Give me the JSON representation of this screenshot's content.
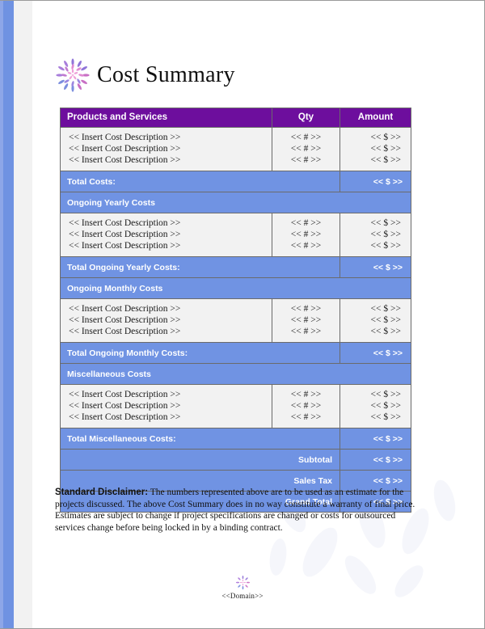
{
  "document": {
    "title": "Cost Summary",
    "logo_icon": "flower-burst-icon",
    "accent_purple": "#6D0E9D",
    "accent_blue": "#7093E3",
    "row_gray": "#F2F2F2"
  },
  "table": {
    "columns": [
      "Products and Services",
      "Qty",
      "Amount"
    ],
    "placeholders": {
      "description": "<< Insert Cost Description >>",
      "qty": "<< # >>",
      "amount": "<< $ >>"
    },
    "rows": [
      {
        "kind": "items",
        "lines": [
          {
            "description": "<< Insert Cost Description >>",
            "qty": "<< # >>",
            "amount": "<< $ >>"
          },
          {
            "description": "<< Insert Cost Description >>",
            "qty": "<< # >>",
            "amount": "<< $ >>"
          },
          {
            "description": "<< Insert Cost Description >>",
            "qty": "<< # >>",
            "amount": "<< $ >>"
          }
        ]
      },
      {
        "kind": "total",
        "label": "Total Costs:",
        "amount": "<< $ >>"
      },
      {
        "kind": "section",
        "label": "Ongoing Yearly Costs"
      },
      {
        "kind": "items",
        "lines": [
          {
            "description": "<< Insert Cost Description >>",
            "qty": "<< # >>",
            "amount": "<< $ >>"
          },
          {
            "description": "<< Insert Cost Description >>",
            "qty": "<< # >>",
            "amount": "<< $ >>"
          },
          {
            "description": "<< Insert Cost Description >>",
            "qty": "<< # >>",
            "amount": "<< $ >>"
          }
        ]
      },
      {
        "kind": "total",
        "label": "Total Ongoing Yearly Costs:",
        "amount": "<< $ >>"
      },
      {
        "kind": "section",
        "label": "Ongoing Monthly Costs"
      },
      {
        "kind": "items",
        "lines": [
          {
            "description": "<< Insert Cost Description >>",
            "qty": "<< # >>",
            "amount": "<< $ >>"
          },
          {
            "description": "<< Insert Cost Description >>",
            "qty": "<< # >>",
            "amount": "<< $ >>"
          },
          {
            "description": "<< Insert Cost Description >>",
            "qty": "<< # >>",
            "amount": "<< $ >>"
          }
        ]
      },
      {
        "kind": "total",
        "label": "Total Ongoing Monthly Costs:",
        "amount": "<< $ >>"
      },
      {
        "kind": "section",
        "label": "Miscellaneous Costs"
      },
      {
        "kind": "items",
        "lines": [
          {
            "description": "<< Insert Cost Description >>",
            "qty": "<< # >>",
            "amount": "<< $ >>"
          },
          {
            "description": "<< Insert Cost Description >>",
            "qty": "<< # >>",
            "amount": "<< $ >>"
          },
          {
            "description": "<< Insert Cost Description >>",
            "qty": "<< # >>",
            "amount": "<< $ >>"
          }
        ]
      },
      {
        "kind": "total",
        "label": "Total Miscellaneous Costs:",
        "amount": "<< $ >>"
      },
      {
        "kind": "sum",
        "label": "Subtotal",
        "amount": "<< $ >>"
      },
      {
        "kind": "sum",
        "label": "Sales Tax",
        "amount": "<< $ >>"
      },
      {
        "kind": "sum",
        "label": "Grand Total",
        "amount": "<< $ >>"
      }
    ]
  },
  "disclaimer": {
    "lead": "Standard Disclaimer:",
    "body": " The numbers represented above are to be used as an estimate for the projects discussed. The above Cost Summary does in no way constitute a warranty of final price.  Estimates are subject to change if project specifications are changed or costs for outsourced services change before being locked in by a binding contract."
  },
  "footer": {
    "logo_icon": "flower-burst-icon",
    "domain": "<<Domain>>"
  }
}
